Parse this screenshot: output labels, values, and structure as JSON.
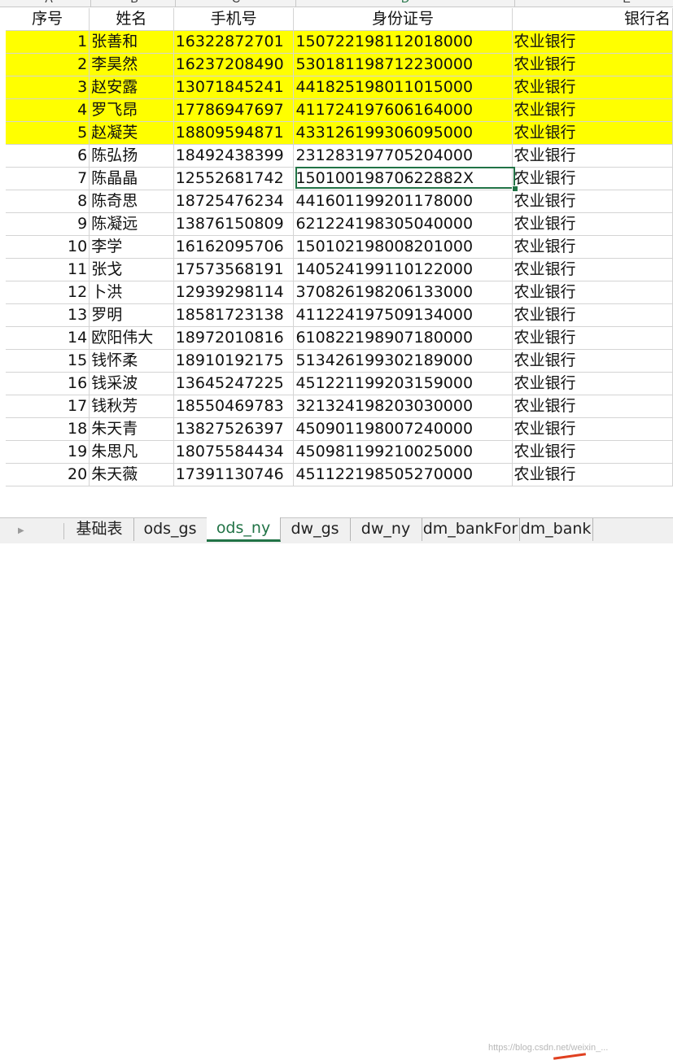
{
  "columns": {
    "letters": [
      "A",
      "B",
      "C",
      "D",
      "E"
    ],
    "headers": [
      "序号",
      "姓名",
      "手机号",
      "身份证号",
      "银行名"
    ]
  },
  "rows": [
    {
      "idx": "1",
      "name": "张善和",
      "phone": "16322872701",
      "id": "150722198112018000",
      "bank": "农业银行",
      "highlight": true
    },
    {
      "idx": "2",
      "name": "李昊然",
      "phone": "16237208490",
      "id": "530181198712230000",
      "bank": "农业银行",
      "highlight": true
    },
    {
      "idx": "3",
      "name": "赵安露",
      "phone": "13071845241",
      "id": "441825198011015000",
      "bank": "农业银行",
      "highlight": true
    },
    {
      "idx": "4",
      "name": "罗飞昂",
      "phone": "17786947697",
      "id": "411724197606164000",
      "bank": "农业银行",
      "highlight": true
    },
    {
      "idx": "5",
      "name": "赵凝芙",
      "phone": "18809594871",
      "id": "433126199306095000",
      "bank": "农业银行",
      "highlight": true
    },
    {
      "idx": "6",
      "name": "陈弘扬",
      "phone": "18492438399",
      "id": "231283197705204000",
      "bank": "农业银行",
      "highlight": false
    },
    {
      "idx": "7",
      "name": "陈晶晶",
      "phone": "12552681742",
      "id": "15010019870622882X",
      "bank": "农业银行",
      "highlight": false
    },
    {
      "idx": "8",
      "name": "陈奇思",
      "phone": "18725476234",
      "id": "441601199201178000",
      "bank": "农业银行",
      "highlight": false
    },
    {
      "idx": "9",
      "name": "陈凝远",
      "phone": "13876150809",
      "id": "621224198305040000",
      "bank": "农业银行",
      "highlight": false
    },
    {
      "idx": "10",
      "name": "李学",
      "phone": "16162095706",
      "id": "150102198008201000",
      "bank": "农业银行",
      "highlight": false
    },
    {
      "idx": "11",
      "name": "张戈",
      "phone": "17573568191",
      "id": "140524199110122000",
      "bank": "农业银行",
      "highlight": false
    },
    {
      "idx": "12",
      "name": "卜洪",
      "phone": "12939298114",
      "id": "370826198206133000",
      "bank": "农业银行",
      "highlight": false
    },
    {
      "idx": "13",
      "name": "罗明",
      "phone": "18581723138",
      "id": "411224197509134000",
      "bank": "农业银行",
      "highlight": false
    },
    {
      "idx": "14",
      "name": "欧阳伟大",
      "phone": "18972010816",
      "id": "610822198907180000",
      "bank": "农业银行",
      "highlight": false
    },
    {
      "idx": "15",
      "name": "钱怀柔",
      "phone": "18910192175",
      "id": "513426199302189000",
      "bank": "农业银行",
      "highlight": false
    },
    {
      "idx": "16",
      "name": "钱采波",
      "phone": "13645247225",
      "id": "451221199203159000",
      "bank": "农业银行",
      "highlight": false
    },
    {
      "idx": "17",
      "name": "钱秋芳",
      "phone": "18550469783",
      "id": "321324198203030000",
      "bank": "农业银行",
      "highlight": false
    },
    {
      "idx": "18",
      "name": "朱天青",
      "phone": "13827526397",
      "id": "450901198007240000",
      "bank": "农业银行",
      "highlight": false
    },
    {
      "idx": "19",
      "name": "朱思凡",
      "phone": "18075584434",
      "id": "450981199210025000",
      "bank": "农业银行",
      "highlight": false
    },
    {
      "idx": "20",
      "name": "朱天薇",
      "phone": "17391130746",
      "id": "451122198505270000",
      "bank": "农业银行",
      "highlight": false
    }
  ],
  "sheet_tabs": [
    {
      "label": "基础表",
      "active": false
    },
    {
      "label": "ods_gs",
      "active": false
    },
    {
      "label": "ods_ny",
      "active": true
    },
    {
      "label": "dw_gs",
      "active": false
    },
    {
      "label": "dw_ny",
      "active": false
    },
    {
      "label": "dm_bankFor",
      "active": false
    },
    {
      "label": "dm_bank",
      "active": false
    }
  ],
  "watermark": "https://blog.csdn.net/weixin_...",
  "colors": {
    "highlight": "#ffff00",
    "accent": "#217346"
  }
}
